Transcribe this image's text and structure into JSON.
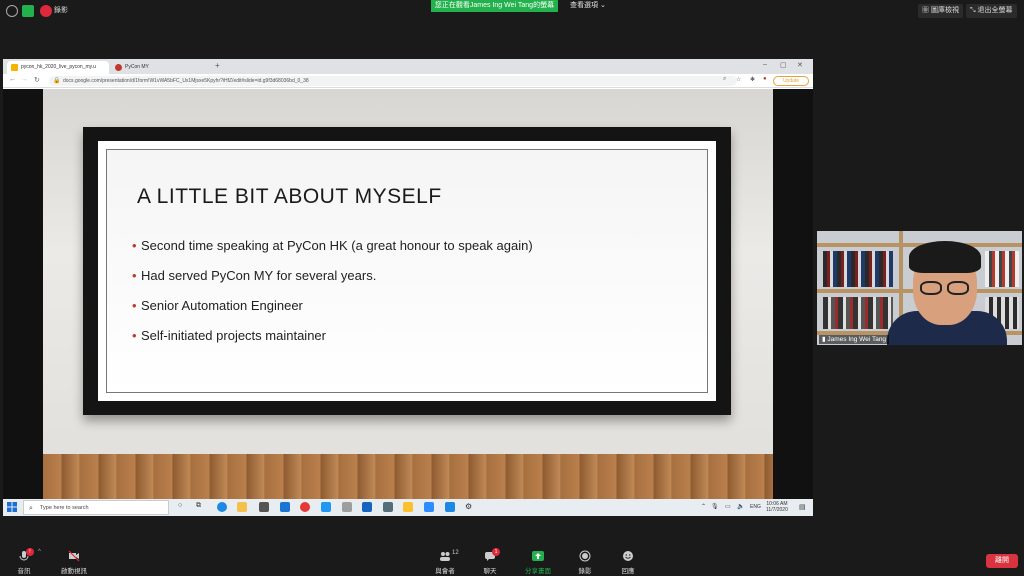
{
  "top_bar": {
    "record_label": "錄影",
    "viewing_banner": "您正在觀看James Ing Wei Tang的螢幕",
    "view_options": "查看選項",
    "gallery_view": "圖庫檢視",
    "exit_fullscreen": "退出全螢幕"
  },
  "browser": {
    "tabs": [
      {
        "label": "pycon_hk_2020_live_pycon_my.u"
      },
      {
        "label": "PyCon MY"
      }
    ],
    "new_tab": "+",
    "url": "docs.google.com/presentation/d/1form!W1vWA5bFC_Ux1Mjsxe5Kpyhr?iHfZ/edit#slide=id.g9f3d68036bd_0_38",
    "update_label": "Update"
  },
  "slide": {
    "title": "A LITTLE BIT ABOUT MYSELF",
    "bullets": [
      "Second time speaking at PyCon HK (a great honour to speak again)",
      "Had served PyCon MY for several years.",
      "Senior Automation Engineer",
      "Self-initiated projects maintainer"
    ]
  },
  "taskbar": {
    "search_placeholder": "Type here to search",
    "lang": "ENG",
    "time": "10:06 AM",
    "date": "11/7/2020"
  },
  "video": {
    "participant_name": "James Ing Wei Tang"
  },
  "bottom_bar": {
    "audio": "音訊",
    "video": "啟動視訊",
    "participants": "與會者",
    "participants_count": "12",
    "chat": "聊天",
    "chat_badge": "1",
    "share_screen": "分享畫面",
    "record": "錄影",
    "reactions": "回應",
    "end": "離開"
  },
  "colors": {
    "share_green": "#23b14d",
    "end_red": "#d9333f",
    "bullet_red": "#c0392b"
  }
}
